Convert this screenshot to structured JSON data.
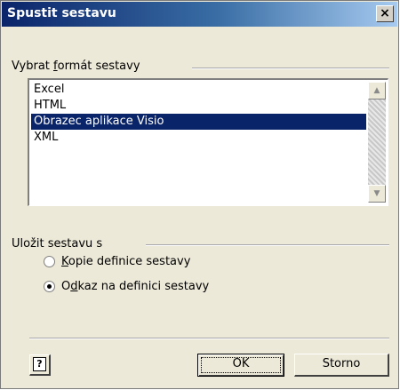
{
  "window": {
    "title": "Spustit sestavu",
    "close_glyph": "×"
  },
  "format_group": {
    "label_before": "Vybrat ",
    "label_accel": "f",
    "label_after": "ormát sestavy",
    "items": [
      "Excel",
      "HTML",
      "Obrazec aplikace Visio",
      "XML"
    ],
    "selected_index": 2
  },
  "save_group": {
    "label": "Uložit sestavu s",
    "options": [
      {
        "accel": "K",
        "rest": "opie definice sestavy",
        "checked": false
      },
      {
        "pre": "O",
        "accel": "d",
        "rest": "kaz na definici sestavy",
        "checked": true
      }
    ]
  },
  "buttons": {
    "ok": "OK",
    "cancel": "Storno",
    "help_icon": "?"
  },
  "icons": {
    "scroll_up": "▲",
    "scroll_down": "▼"
  },
  "colors": {
    "title_start": "#0a246a",
    "selection": "#0a246a",
    "dialog_face": "#ece9d8"
  }
}
